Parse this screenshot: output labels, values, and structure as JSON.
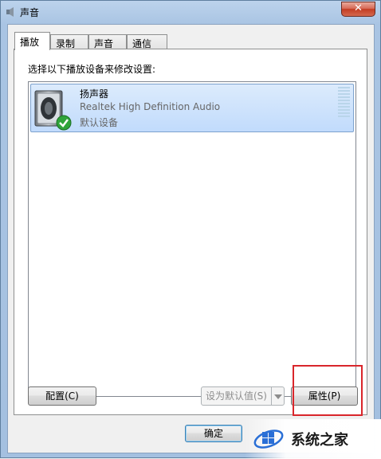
{
  "window": {
    "title": "声音",
    "close_label": "✕"
  },
  "tabs": [
    {
      "label": "播放",
      "active": true
    },
    {
      "label": "录制",
      "active": false
    },
    {
      "label": "声音",
      "active": false
    },
    {
      "label": "通信",
      "active": false
    }
  ],
  "panel": {
    "prompt": "选择以下播放设备来修改设置:",
    "devices": [
      {
        "name": "扬声器",
        "description": "Realtek High Definition Audio",
        "status": "默认设备",
        "icon": "speaker-icon",
        "status_icon": "green-check-icon"
      }
    ]
  },
  "buttons": {
    "configure": "配置(C)",
    "set_default": "设为默认值(S)",
    "properties": "属性(P)",
    "ok": "确定"
  },
  "watermark": {
    "text": "系统之家"
  },
  "colors": {
    "highlight": "#d9262b",
    "selection": "#c1dbfc"
  }
}
